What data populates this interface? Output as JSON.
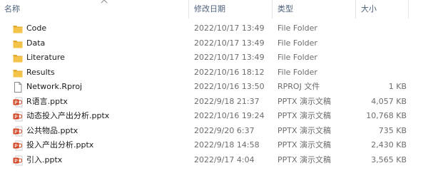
{
  "columns": {
    "name": "名称",
    "date": "修改日期",
    "type": "类型",
    "size": "大小"
  },
  "files": [
    {
      "name": "Code",
      "date": "2022/10/17 13:49",
      "type": "File Folder",
      "size": "",
      "icon": "folder-icon"
    },
    {
      "name": "Data",
      "date": "2022/10/17 13:49",
      "type": "File Folder",
      "size": "",
      "icon": "folder-icon"
    },
    {
      "name": "Literature",
      "date": "2022/10/17 13:49",
      "type": "File Folder",
      "size": "",
      "icon": "folder-icon"
    },
    {
      "name": "Results",
      "date": "2022/10/16 18:12",
      "type": "File Folder",
      "size": "",
      "icon": "folder-icon"
    },
    {
      "name": "Network.Rproj",
      "date": "2022/10/16 13:50",
      "type": "RPROJ 文件",
      "size": "1 KB",
      "icon": "document-icon"
    },
    {
      "name": "R语言.pptx",
      "date": "2022/9/18 21:37",
      "type": "PPTX 演示文稿",
      "size": "4,057 KB",
      "icon": "powerpoint-icon"
    },
    {
      "name": "动态投入产出分析.pptx",
      "date": "2022/10/16 19:24",
      "type": "PPTX 演示文稿",
      "size": "10,768 KB",
      "icon": "powerpoint-icon"
    },
    {
      "name": "公共物品.pptx",
      "date": "2022/9/20 6:37",
      "type": "PPTX 演示文稿",
      "size": "735 KB",
      "icon": "powerpoint-icon"
    },
    {
      "name": "投入产出分析.pptx",
      "date": "2022/9/18 14:58",
      "type": "PPTX 演示文稿",
      "size": "2,430 KB",
      "icon": "powerpoint-icon"
    },
    {
      "name": "引入.pptx",
      "date": "2022/9/17 4:04",
      "type": "PPTX 演示文稿",
      "size": "3,565 KB",
      "icon": "powerpoint-icon"
    }
  ],
  "colors": {
    "folder": "#f3c34a",
    "folder_dark": "#e3a82b",
    "powerpoint": "#d24726",
    "header_text": "#4c607a",
    "detail_text": "#6d6d6d"
  }
}
